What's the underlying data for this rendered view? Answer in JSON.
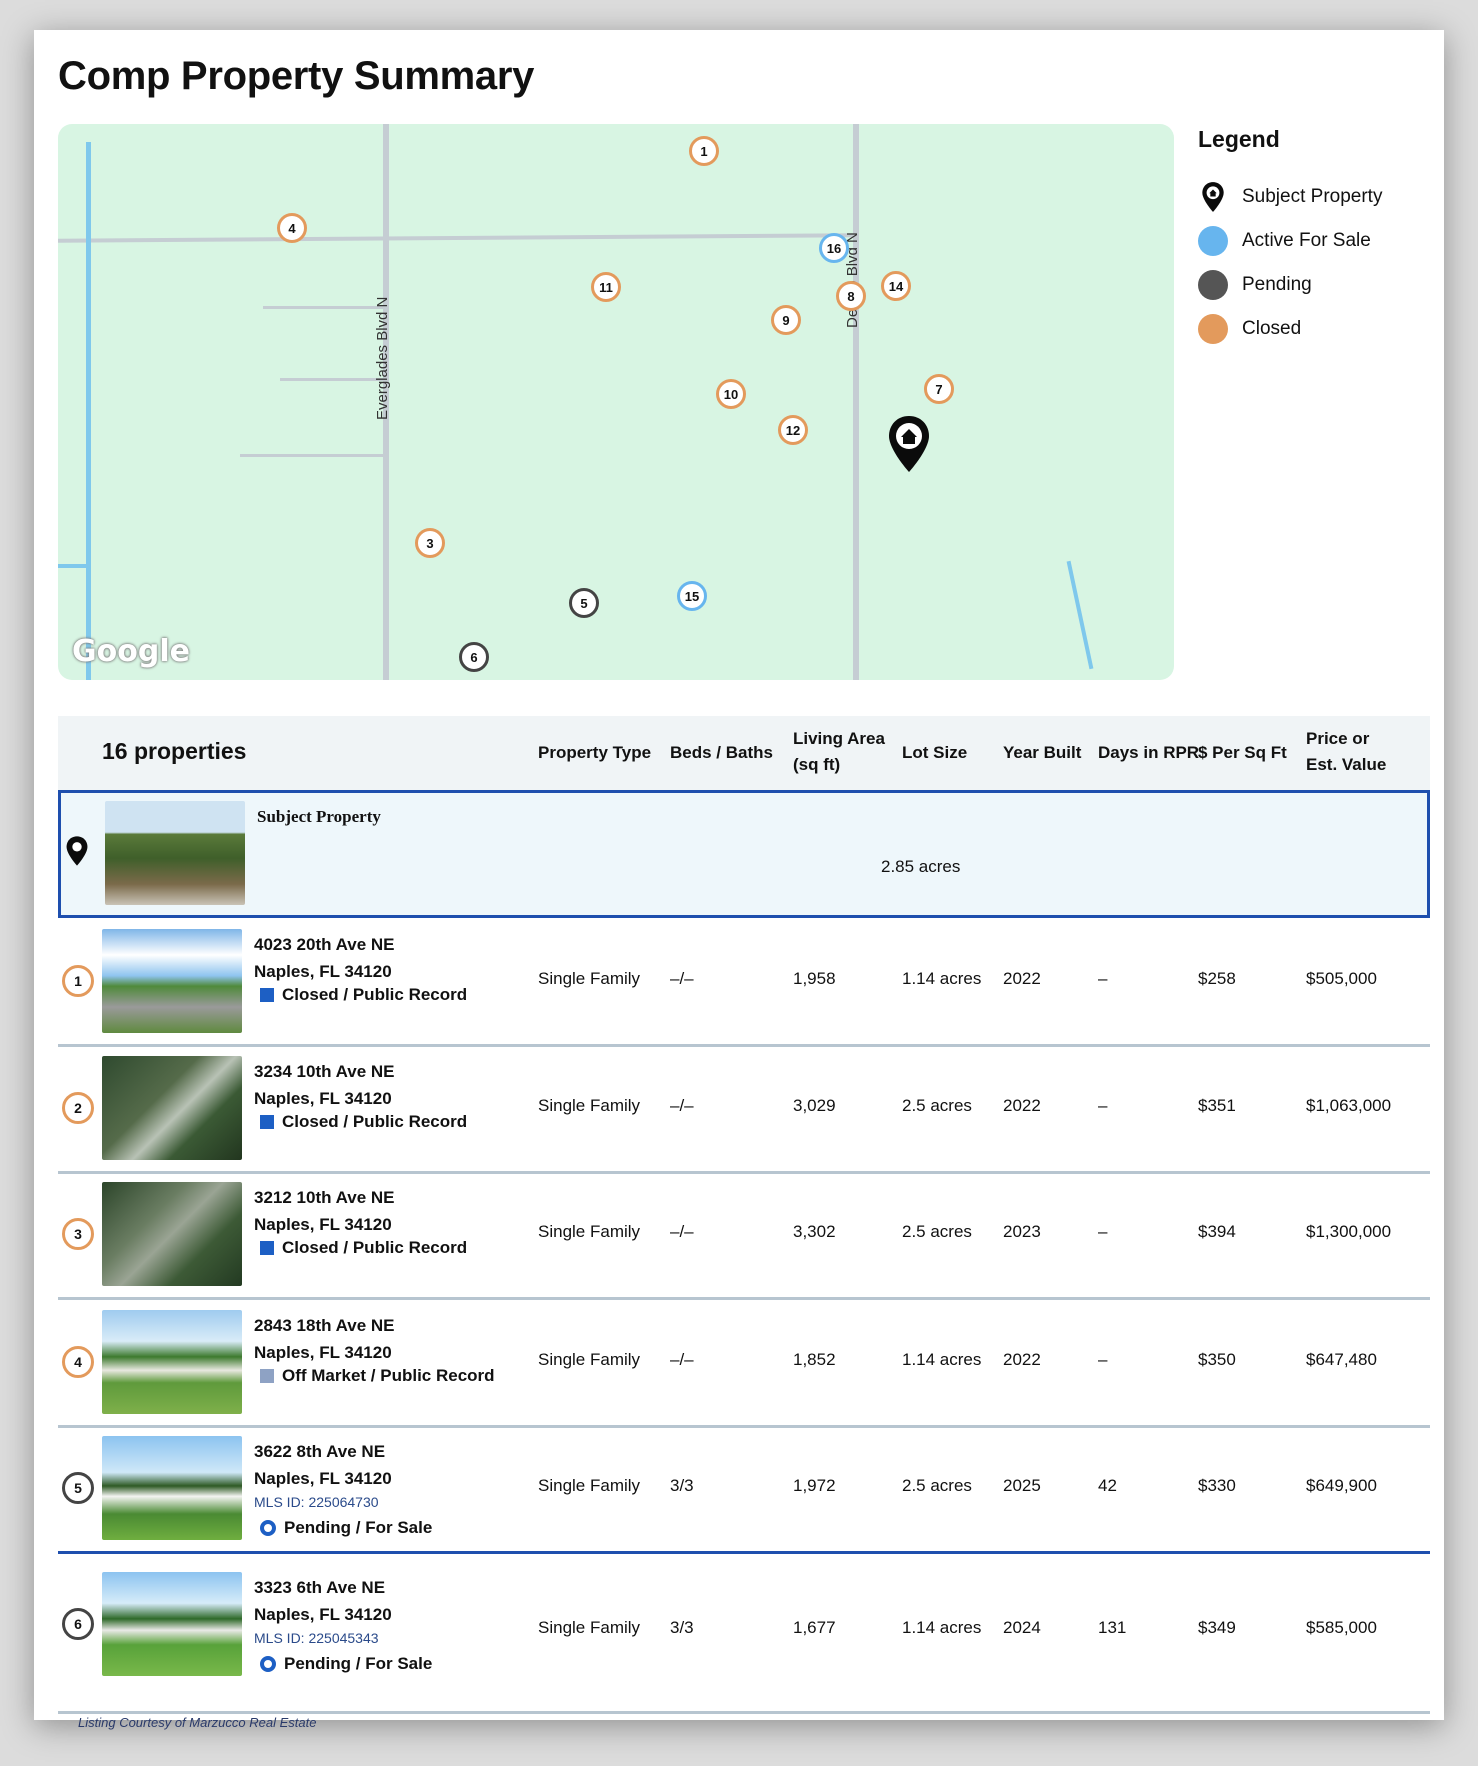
{
  "title": "Comp Property Summary",
  "map": {
    "roads": {
      "everglades": "Everglades Blvd N",
      "desoto": "Desoto Blvd N"
    },
    "attribution": "Google",
    "markers": [
      {
        "label": "1",
        "status": "closed"
      },
      {
        "label": "4",
        "status": "closed"
      },
      {
        "label": "16",
        "status": "active"
      },
      {
        "label": "11",
        "status": "closed"
      },
      {
        "label": "8",
        "status": "closed"
      },
      {
        "label": "14",
        "status": "closed"
      },
      {
        "label": "9",
        "status": "closed"
      },
      {
        "label": "7",
        "status": "closed"
      },
      {
        "label": "10",
        "status": "closed"
      },
      {
        "label": "12",
        "status": "closed"
      },
      {
        "label": "3",
        "status": "closed"
      },
      {
        "label": "5",
        "status": "pending"
      },
      {
        "label": "15",
        "status": "active"
      },
      {
        "label": "6",
        "status": "pending"
      }
    ]
  },
  "legend": {
    "title": "Legend",
    "items": [
      {
        "label": "Subject Property",
        "color": "#111111",
        "icon": "home-pin-icon"
      },
      {
        "label": "Active For Sale",
        "color": "#67b5ee"
      },
      {
        "label": "Pending",
        "color": "#555555"
      },
      {
        "label": "Closed",
        "color": "#e39a5c"
      }
    ]
  },
  "table": {
    "count_label": "16 properties",
    "headers": {
      "type": "Property Type",
      "beds": "Beds / Baths",
      "area_1": "Living Area",
      "area_2": "(sq ft)",
      "lot": "Lot Size",
      "year": "Year Built",
      "days": "Days in RPR",
      "ppsf": "$ Per Sq Ft",
      "price_1": "Price or",
      "price_2": "Est. Value"
    },
    "subject": {
      "label": "Subject Property",
      "lot": "2.85 acres"
    },
    "rows": [
      {
        "num": "1",
        "street": "4023 20th Ave NE",
        "city": "Naples, FL 34120",
        "status": "Closed / Public Record",
        "status_color": "#1d5fc4",
        "type": "Single Family",
        "beds": "–/–",
        "area": "1,958",
        "lot": "1.14 acres",
        "year": "2022",
        "days": "–",
        "ppsf": "$258",
        "price": "$505,000"
      },
      {
        "num": "2",
        "street": "3234 10th Ave NE",
        "city": "Naples, FL 34120",
        "status": "Closed / Public Record",
        "status_color": "#1d5fc4",
        "type": "Single Family",
        "beds": "–/–",
        "area": "3,029",
        "lot": "2.5 acres",
        "year": "2022",
        "days": "–",
        "ppsf": "$351",
        "price": "$1,063,000"
      },
      {
        "num": "3",
        "street": "3212 10th Ave NE",
        "city": "Naples, FL 34120",
        "status": "Closed / Public Record",
        "status_color": "#1d5fc4",
        "type": "Single Family",
        "beds": "–/–",
        "area": "3,302",
        "lot": "2.5 acres",
        "year": "2023",
        "days": "–",
        "ppsf": "$394",
        "price": "$1,300,000"
      },
      {
        "num": "4",
        "street": "2843 18th Ave NE",
        "city": "Naples, FL 34120",
        "status": "Off Market / Public Record",
        "status_color": "#8ea2c4",
        "type": "Single Family",
        "beds": "–/–",
        "area": "1,852",
        "lot": "1.14 acres",
        "year": "2022",
        "days": "–",
        "ppsf": "$350",
        "price": "$647,480"
      },
      {
        "num": "5",
        "street": "3622 8th Ave NE",
        "city": "Naples, FL 34120",
        "mls": "MLS ID: 225064730",
        "status": "Pending / For Sale",
        "status_color": "#1d5fc4",
        "type": "Single Family",
        "beds": "3/3",
        "area": "1,972",
        "lot": "2.5 acres",
        "year": "2025",
        "days": "42",
        "ppsf": "$330",
        "price": "$649,900"
      },
      {
        "num": "6",
        "street": "3323 6th Ave NE",
        "city": "Naples, FL 34120",
        "mls": "MLS ID: 225045343",
        "status": "Pending / For Sale",
        "status_color": "#1d5fc4",
        "type": "Single Family",
        "beds": "3/3",
        "area": "1,677",
        "lot": "1.14 acres",
        "year": "2024",
        "days": "131",
        "ppsf": "$349",
        "price": "$585,000"
      }
    ],
    "courtesy": "Listing Courtesy of Marzucco Real Estate"
  }
}
